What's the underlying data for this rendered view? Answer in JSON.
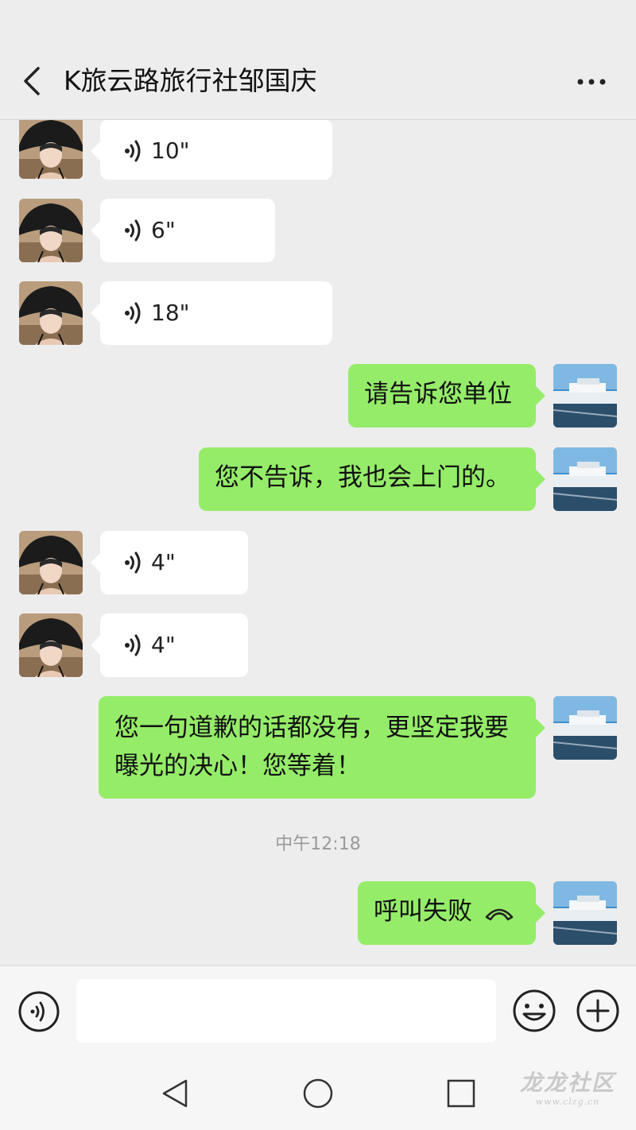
{
  "header": {
    "title": "K旅云路旅行社邹国庆"
  },
  "messages": {
    "m1": {
      "duration": "10\""
    },
    "m2": {
      "duration": "6\""
    },
    "m3": {
      "duration": "18\""
    },
    "m4": {
      "text": "请告诉您单位"
    },
    "m5": {
      "text": "您不告诉，我也会上门的。"
    },
    "m6": {
      "duration": "4\""
    },
    "m7": {
      "duration": "4\""
    },
    "m8": {
      "text": "您一句道歉的话都没有，更坚定我要曝光的决心！您等着！"
    },
    "timestamp": "中午12:18",
    "m9": {
      "text": "呼叫失败"
    }
  },
  "icons": {
    "back": "chevron-left-icon",
    "more": "more-dots-icon",
    "voice": "voice-wave-icon",
    "emoji": "smiley-icon",
    "plus": "plus-circle-icon",
    "call": "hangup-icon"
  },
  "colors": {
    "sent_bubble": "#95ec69",
    "received_bubble": "#ffffff",
    "background": "#ededed"
  },
  "watermark": {
    "main": "龙龙社区",
    "sub": "www.clzg.cn"
  }
}
